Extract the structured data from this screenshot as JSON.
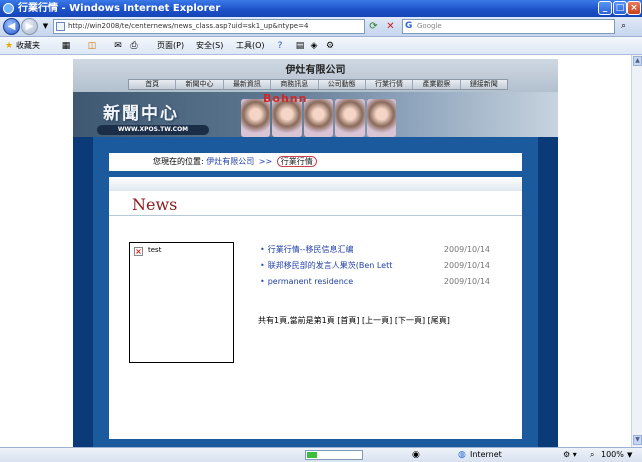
{
  "window": {
    "title": "行業行情 - Windows Internet Explorer"
  },
  "address": {
    "url": "http://win2008/te/centernews/news_class.asp?uid=sk1_up&ntype=4"
  },
  "search": {
    "placeholder": "Google"
  },
  "commandbar": {
    "favorites": "收藏夹",
    "page": "页面(P)",
    "safety": "安全(S)",
    "tools": "工具(O)"
  },
  "site": {
    "company": "伊灶有限公司",
    "menu": [
      "首頁",
      "新聞中心",
      "最新資訊",
      "商務訊息",
      "公司動態",
      "行業行情",
      "產業觀察",
      "鏈接新聞"
    ],
    "logo_text": "新聞中心",
    "logo_url": "WWW.XPOS.TW.COM",
    "banner_text": "Bohnn"
  },
  "breadcrumb": {
    "prefix": "您現在的位置:",
    "home": "伊灶有限公司",
    "sep": ">>",
    "current": "行業行情"
  },
  "section_title": "News",
  "image_alt": "test",
  "news": [
    {
      "title": "行業行情--移民信息汇编",
      "date": "2009/10/14"
    },
    {
      "title": "联邦移民部的发言人果茨(Ben Lett",
      "date": "2009/10/14"
    },
    {
      "title": "permanent residence",
      "date": "2009/10/14"
    }
  ],
  "pager": "共有1頁,當前是第1頁 [首頁] [上一頁] [下一頁] [尾頁]",
  "status": {
    "zone": "Internet",
    "zoom": "100%"
  }
}
